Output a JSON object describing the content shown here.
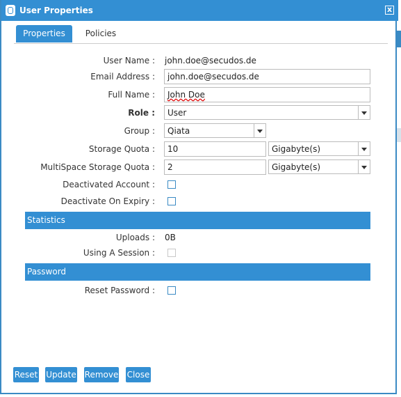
{
  "window": {
    "title": "User Properties",
    "close_label": "x"
  },
  "tabs": [
    {
      "label": "Properties",
      "active": true
    },
    {
      "label": "Policies",
      "active": false
    }
  ],
  "form": {
    "user_name": {
      "label": "User Name :",
      "value": "john.doe@secudos.de"
    },
    "email": {
      "label": "Email Address :",
      "value": "john.doe@secudos.de"
    },
    "full_name": {
      "label": "Full Name :",
      "value": "John Doe"
    },
    "role": {
      "label": "Role :",
      "value": "User"
    },
    "group": {
      "label": "Group :",
      "value": "Qiata"
    },
    "storage_quota": {
      "label": "Storage Quota :",
      "value": "10",
      "unit": "Gigabyte(s)"
    },
    "multispace_quota": {
      "label": "MultiSpace Storage Quota :",
      "value": "2",
      "unit": "Gigabyte(s)"
    },
    "deactivated_account": {
      "label": "Deactivated Account :",
      "checked": false
    },
    "deactivate_on_expiry": {
      "label": "Deactivate On Expiry :",
      "checked": false
    }
  },
  "statistics": {
    "header": "Statistics",
    "uploads": {
      "label": "Uploads :",
      "value": "0B"
    },
    "using_session": {
      "label": "Using A Session :",
      "checked": false
    }
  },
  "password": {
    "header": "Password",
    "reset": {
      "label": "Reset Password :",
      "checked": false
    }
  },
  "buttons": {
    "reset": "Reset",
    "update": "Update",
    "remove": "Remove",
    "close": "Close"
  },
  "colors": {
    "accent": "#338fd3",
    "border": "#3a8ac4"
  }
}
